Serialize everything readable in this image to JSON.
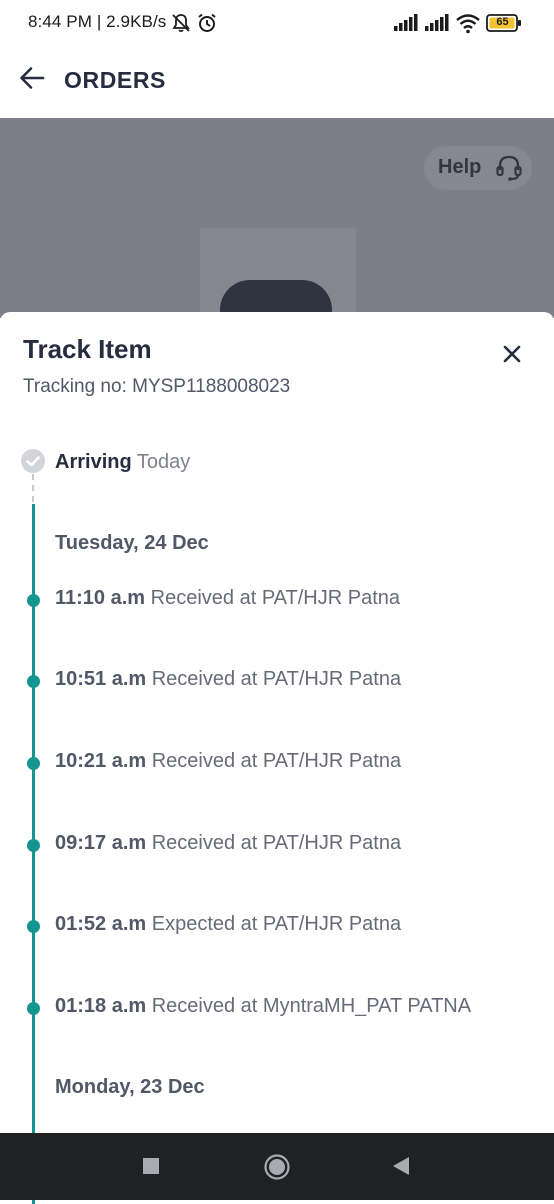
{
  "status_bar": {
    "left_text": "8:44 PM | 2.9KB/s",
    "battery_level": "65",
    "icons": [
      "mute-bell-icon",
      "alarm-icon",
      "signal-icon",
      "signal-icon",
      "wifi-icon",
      "battery-icon"
    ]
  },
  "header": {
    "title": "ORDERS",
    "back_icon": "arrow-left-icon"
  },
  "background": {
    "help_label": "Help",
    "help_icon": "headset-icon"
  },
  "sheet": {
    "title": "Track Item",
    "tracking_label": "Tracking no: MYSP1188008023",
    "close_icon": "close-icon",
    "arriving": {
      "label": "Arriving",
      "when": "Today"
    },
    "groups": [
      {
        "date": "Tuesday, 24 Dec",
        "events": [
          {
            "time": "11:10 a.m",
            "text": "Received at PAT/HJR Patna"
          },
          {
            "time": "10:51 a.m",
            "text": "Received at PAT/HJR Patna"
          },
          {
            "time": "10:21 a.m",
            "text": "Received at PAT/HJR Patna"
          },
          {
            "time": "09:17 a.m",
            "text": "Received at PAT/HJR Patna"
          },
          {
            "time": "01:52 a.m",
            "text": "Expected at PAT/HJR Patna"
          },
          {
            "time": "01:18 a.m",
            "text": "Received at MyntraMH_PAT PATNA"
          }
        ]
      },
      {
        "date": "Monday, 23 Dec",
        "events": []
      }
    ]
  },
  "colors": {
    "accent": "#14958f",
    "text_dark": "#282c3f",
    "text_muted": "#686b77",
    "overlay": "#7d7f88",
    "nav_bar": "#1f2124"
  },
  "nav_bar": {
    "buttons": [
      "recents-square-icon",
      "home-circle-icon",
      "back-triangle-icon"
    ]
  }
}
